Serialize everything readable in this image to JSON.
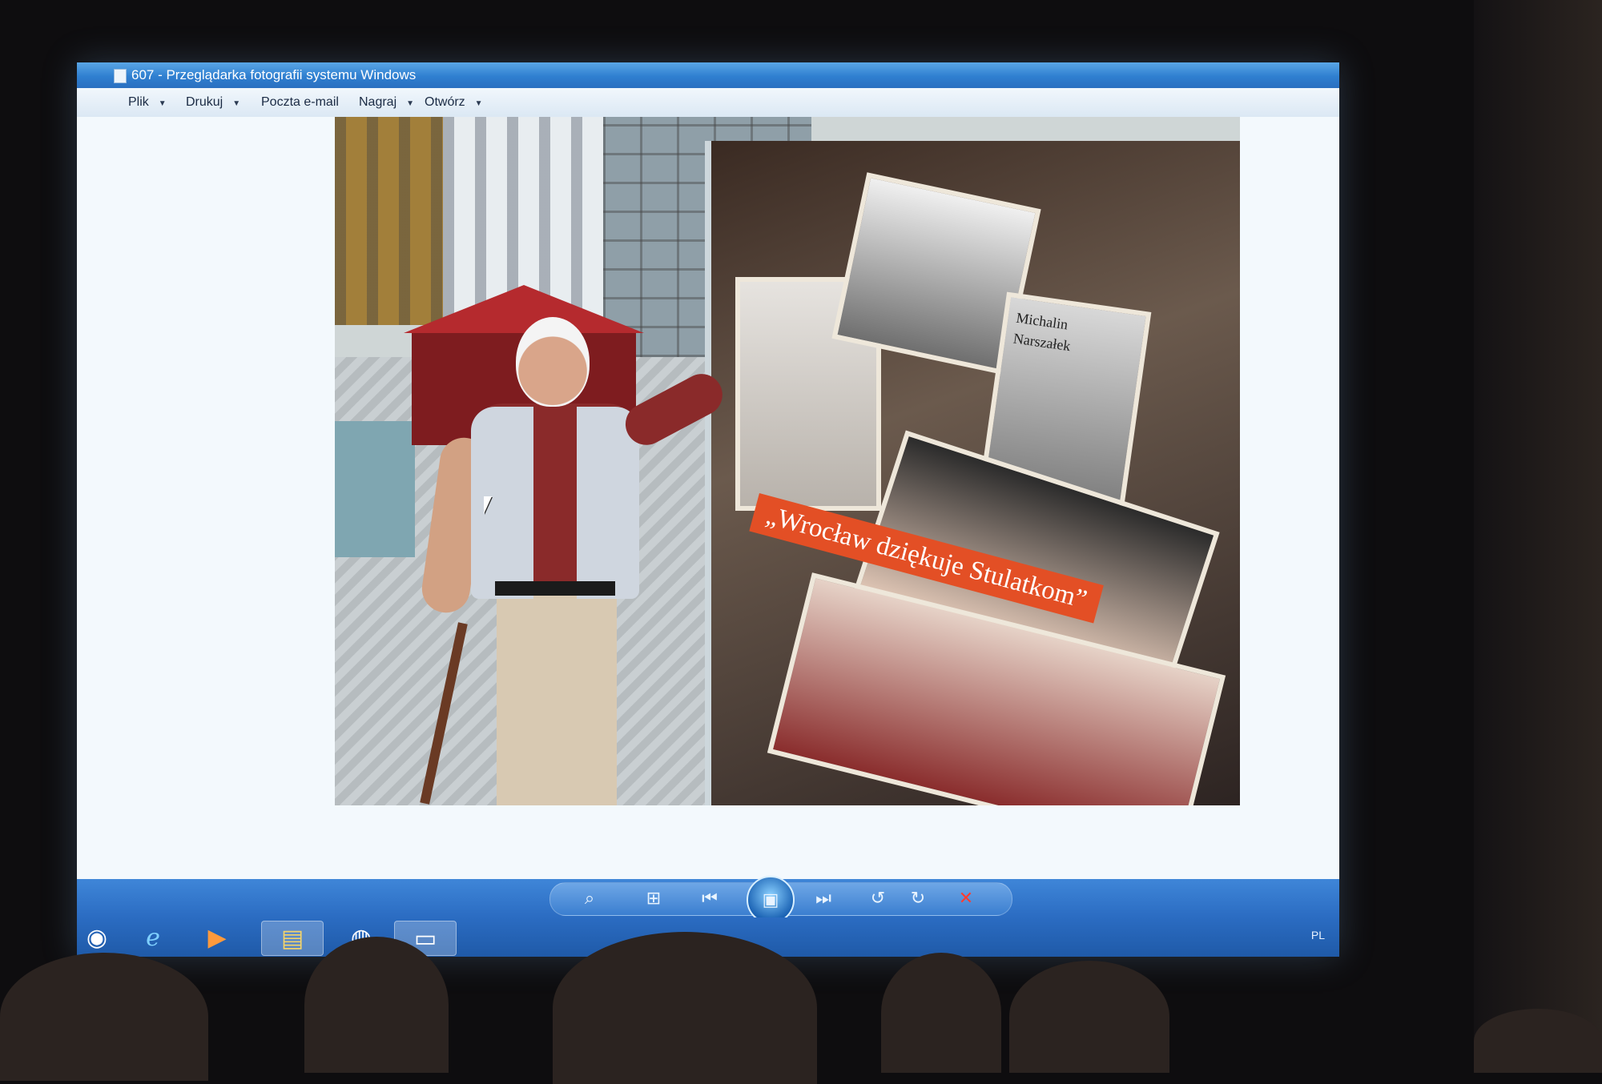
{
  "window": {
    "title": "607 - Przeglądarka fotografii systemu Windows"
  },
  "menu": {
    "items": [
      {
        "label": "Plik",
        "dropdown": true
      },
      {
        "label": "Drukuj",
        "dropdown": true
      },
      {
        "label": "Poczta e-mail",
        "dropdown": false
      },
      {
        "label": "Nagraj",
        "dropdown": true
      },
      {
        "label": "Otwórz",
        "dropdown": true
      }
    ]
  },
  "photo": {
    "caption": "„Wrocław dziękuje Stulatkom”",
    "board_text_1": "Michalin",
    "board_text_2": "Narszałek"
  },
  "controls": {
    "icons": [
      "zoom-icon",
      "fit-window-icon",
      "previous-icon",
      "slideshow-icon",
      "next-icon",
      "rotate-left-icon",
      "rotate-right-icon",
      "delete-icon"
    ]
  },
  "taskbar": {
    "items": [
      "start-orb-icon",
      "internet-explorer-icon",
      "media-player-icon",
      "explorer-folder-icon",
      "chrome-icon",
      "photo-viewer-icon"
    ],
    "language": "PL"
  },
  "colors": {
    "titlebar": "#2f7fd0",
    "taskbar": "#1f5aa8",
    "caption_bg": "#e34f25",
    "delete": "#ff3c2f"
  }
}
